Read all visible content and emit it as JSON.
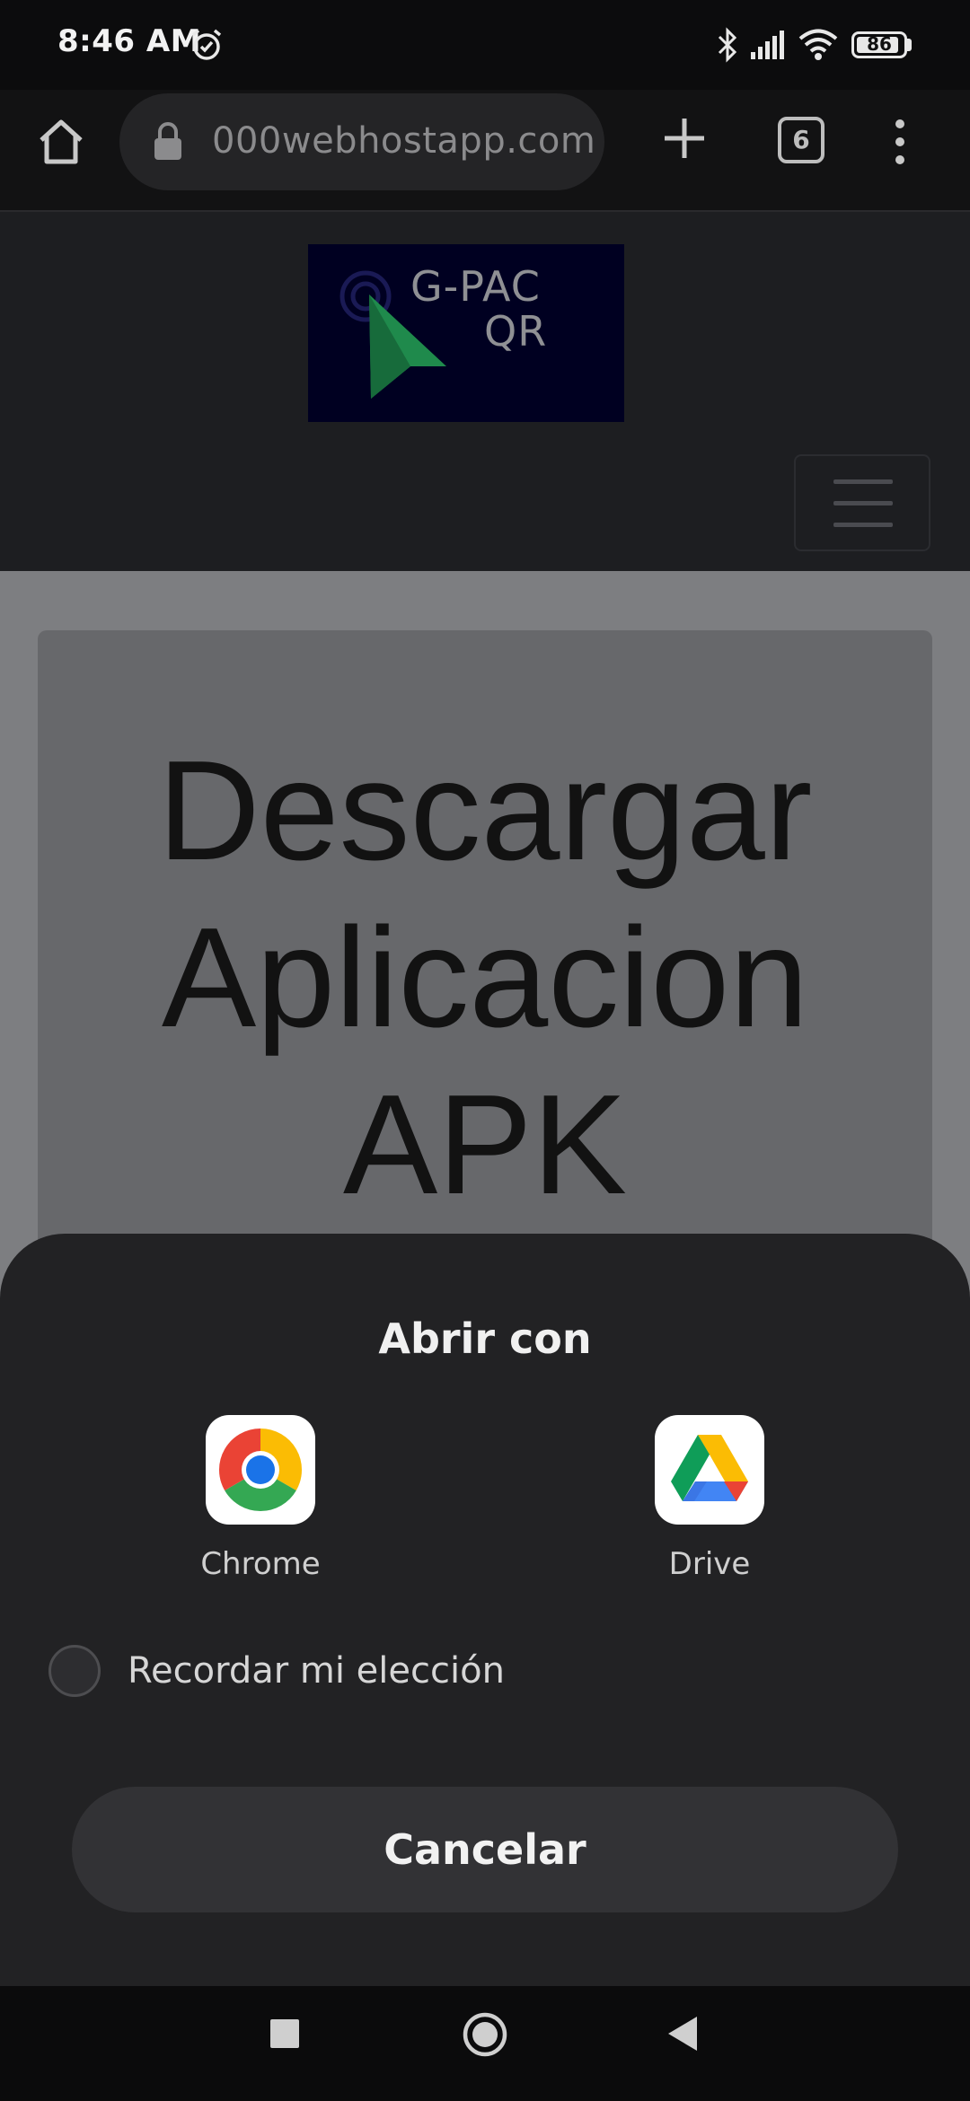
{
  "status_bar": {
    "time": "8:46 AM",
    "battery": "86",
    "battery_level": 0.86,
    "icons": [
      "alarm-icon",
      "bluetooth-icon",
      "signal-icon",
      "wifi-icon",
      "battery-icon"
    ]
  },
  "browser": {
    "url": "000webhostapp.com",
    "tab_count": "6",
    "icons": [
      "home-icon",
      "lock-icon",
      "plus-icon",
      "tabs-icon",
      "more-vert-icon"
    ]
  },
  "website": {
    "logo_line1": "G-PAC",
    "logo_line2": "QR",
    "hero_title_lines": [
      "Descargar",
      "Aplicacion",
      "APK"
    ]
  },
  "dialog": {
    "title": "Abrir con",
    "apps": [
      {
        "label": "Chrome",
        "icon": "chrome-icon"
      },
      {
        "label": "Drive",
        "icon": "google-drive-icon"
      }
    ],
    "remember_label": "Recordar mi elección",
    "remember_checked": false,
    "cancel_label": "Cancelar"
  },
  "nav_bar": {
    "icons": [
      "recents-square-icon",
      "home-circle-icon",
      "back-triangle-icon"
    ]
  },
  "colors": {
    "sheet_bg": "#222224",
    "button_bg": "#323235",
    "logo_bg": "#000021",
    "logo_arrow": "#1f8a4c"
  }
}
